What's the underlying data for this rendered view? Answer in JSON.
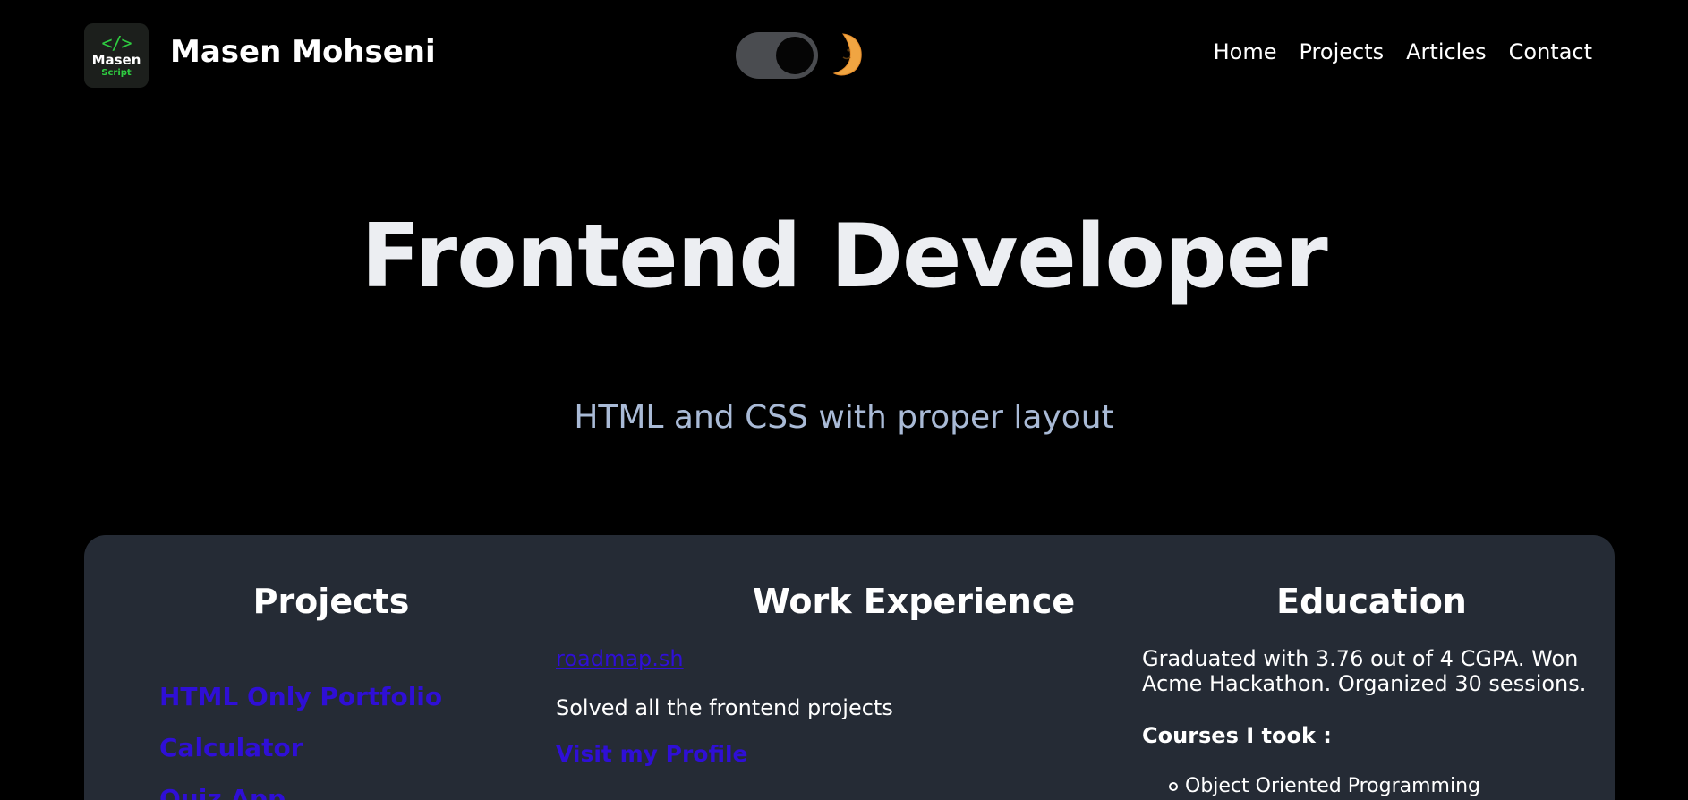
{
  "header": {
    "logo": {
      "code": "</>",
      "main": "Masen",
      "sub": "Script"
    },
    "site_name": "Masen Mohseni",
    "theme_toggle": {
      "state": "dark"
    },
    "nav": [
      {
        "label": "Home"
      },
      {
        "label": "Projects"
      },
      {
        "label": "Articles"
      },
      {
        "label": "Contact"
      }
    ]
  },
  "hero": {
    "title": "Frontend Developer",
    "subtitle": "HTML and CSS with proper layout"
  },
  "sections": {
    "projects": {
      "title": "Projects",
      "items": [
        "HTML Only Portfolio",
        "Calculator",
        "Quiz App"
      ]
    },
    "work": {
      "title": "Work Experience",
      "company": "roadmap.sh",
      "description": "Solved all the frontend projects",
      "link": "Visit my Profile"
    },
    "education": {
      "title": "Education",
      "text": "Graduated with 3.76 out of 4 CGPA. Won Acme Hackathon. Organized 30 sessions.",
      "courses_label": "Courses I took :",
      "courses": [
        "Object Oriented Programming"
      ]
    }
  },
  "colors": {
    "background": "#000000",
    "card": "#252b35",
    "link": "#2f0fd6",
    "logo_green": "#2ecc40"
  }
}
